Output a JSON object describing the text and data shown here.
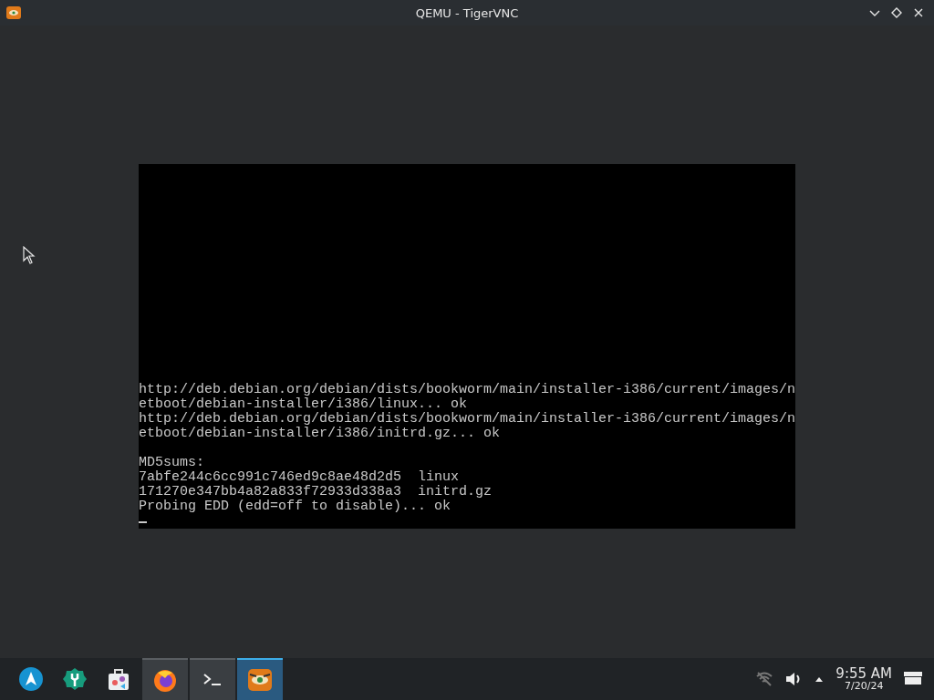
{
  "window": {
    "title": "QEMU - TigerVNC"
  },
  "console": {
    "blocks": [
      [
        "http://deb.debian.org/debian/dists/bookworm/main/installer-i386/current/images/n",
        "etboot/debian-installer/i386/linux... ok",
        "http://deb.debian.org/debian/dists/bookworm/main/installer-i386/current/images/n",
        "etboot/debian-installer/i386/initrd.gz... ok"
      ],
      [
        "MD5sums:",
        "7abfe244c6cc991c746ed9c8ae48d2d5  linux",
        "171270e347bb4a82a833f72933d338a3  initrd.gz",
        "Probing EDD (edd=off to disable)... ok"
      ]
    ]
  },
  "taskbar": {
    "tasks": [
      {
        "selected": false
      },
      {
        "selected": false
      },
      {
        "selected": true
      }
    ],
    "clock": {
      "time": "9:55 AM",
      "date": "7/20/24"
    }
  }
}
